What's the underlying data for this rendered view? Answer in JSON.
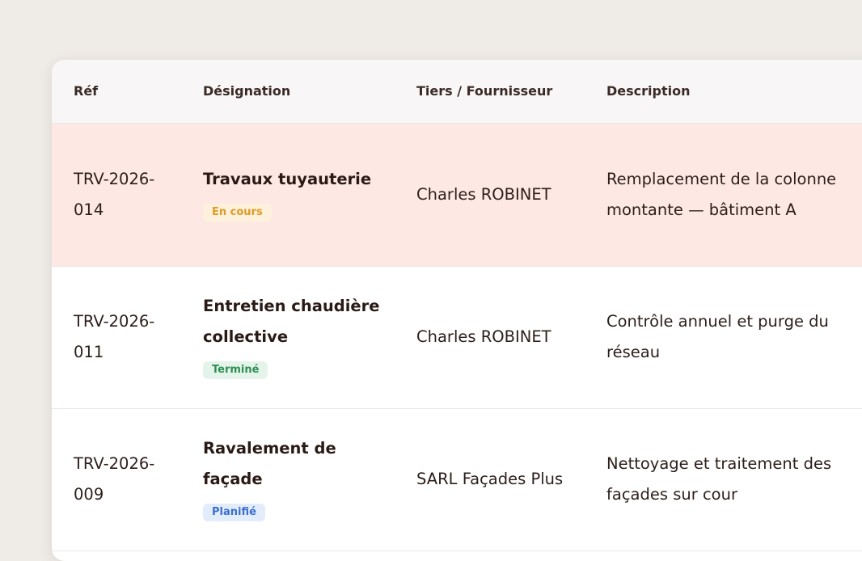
{
  "table": {
    "headers": {
      "ref": "Réf",
      "designation": "Désignation",
      "tiers": "Tiers / Fournisseur",
      "description": "Description"
    },
    "rows": [
      {
        "ref": "TRV-2026-014",
        "designation": "Travaux tuyauterie",
        "status": "En cours",
        "tiers": "Charles ROBINET",
        "description": "Remplacement de la colonne montante — bâtiment A"
      },
      {
        "ref": "TRV-2026-011",
        "designation": "Entretien chaudière collective",
        "status": "Terminé",
        "tiers": "Charles ROBINET",
        "description": "Contrôle annuel et purge du réseau"
      },
      {
        "ref": "TRV-2026-009",
        "designation": "Ravalement de façade",
        "status": "Planifié",
        "tiers": "SARL Façades Plus",
        "description": "Nettoyage et traitement des façades sur cour"
      }
    ]
  },
  "colors": {
    "page_background": "#efebe7",
    "highlight_row": "#fde8e3",
    "status_en_cours": "#e09a26",
    "status_termine": "#2e8f55",
    "status_planifie": "#3b6fcf"
  }
}
